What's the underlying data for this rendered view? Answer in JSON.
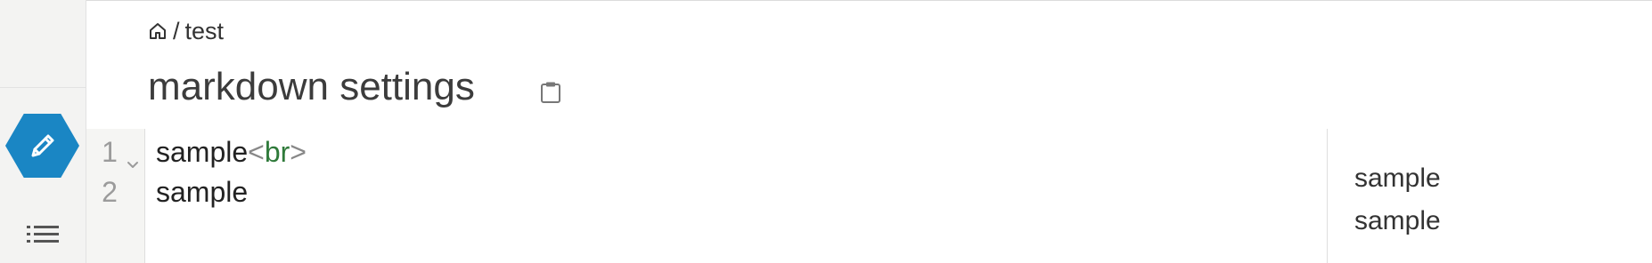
{
  "breadcrumb": {
    "separator": "/",
    "current": "test"
  },
  "page": {
    "title": "markdown settings"
  },
  "editor": {
    "lines": [
      {
        "number": "1",
        "text": "sample",
        "tag_open": "<",
        "tag_name": "br",
        "tag_close": ">"
      },
      {
        "number": "2",
        "text": "sample"
      }
    ]
  },
  "preview": {
    "line1": "sample",
    "line2": "sample"
  },
  "icons": {
    "edit": "pencil-icon",
    "list": "list-icon",
    "home": "home-icon",
    "clipboard": "clipboard-icon",
    "fold": "chevron-down-icon"
  },
  "colors": {
    "accent": "#1a86c4",
    "tag": "#2f7a3a",
    "rail_background": "#f3f3f2"
  }
}
